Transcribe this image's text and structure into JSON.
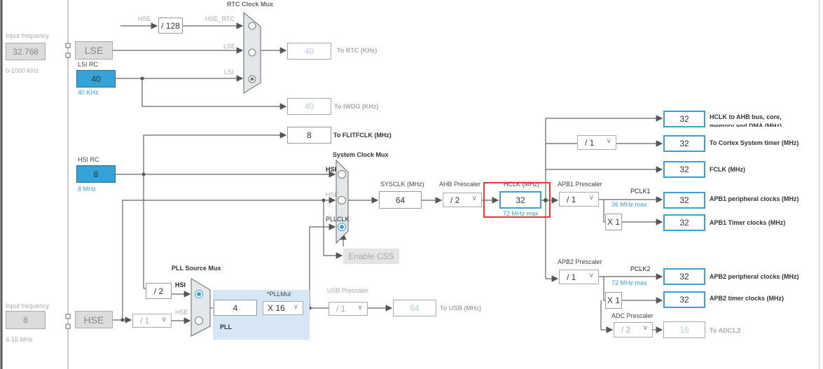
{
  "lse_input": {
    "label": "Input frequency",
    "value": "32.768",
    "range": "0-1000 KHz",
    "block": "LSE"
  },
  "lsi": {
    "label": "LSI RC",
    "value": "40",
    "freq": "40 KHz"
  },
  "hsi": {
    "label": "HSI RC",
    "value": "8",
    "freq": "8 MHz"
  },
  "hse_input": {
    "label": "Input frequency",
    "value": "8",
    "range": "4-16 MHz",
    "block": "HSE"
  },
  "rtc_mux": {
    "title": "RTC Clock Mux",
    "hse_in": "HSE",
    "div": "/ 128",
    "hse_rtc": "HSE_RTC",
    "lse": "LSE",
    "lsi": "LSI",
    "selected": "LSI"
  },
  "to_rtc": {
    "value": "40",
    "label": "To RTC (KHz)"
  },
  "to_iwdg": {
    "value": "40",
    "label": "To IWDG (KHz)"
  },
  "to_flitf": {
    "value": "8",
    "label": "To FLITFCLK (MHz)"
  },
  "sys_mux": {
    "title": "System Clock Mux",
    "hsi": "HSI",
    "hse": "HSE",
    "pllclk": "PLLCLK",
    "selected": "PLLCLK",
    "enable_css": "Enable CSS"
  },
  "sysclk": {
    "label": "SYSCLK (MHz)",
    "value": "64"
  },
  "ahb": {
    "label": "AHB Prescaler",
    "value": "/ 2"
  },
  "hclk": {
    "label": "HCLK (MHz)",
    "value": "32",
    "max": "72 MHz max"
  },
  "outputs": {
    "ahb": {
      "value": "32",
      "label": "HCLK to AHB bus, core, memory and DMA (MHz)"
    },
    "cortex": {
      "div": "/ 1",
      "value": "32",
      "label": "To Cortex System timer (MHz)"
    },
    "fclk": {
      "value": "32",
      "label": "FCLK (MHz)"
    },
    "apb1_periph": {
      "value": "32",
      "label": "APB1 peripheral clocks (MHz)"
    },
    "apb1_timer": {
      "mul": "X 1",
      "value": "32",
      "label": "APB1 Timer clocks (MHz)"
    },
    "apb2_periph": {
      "value": "32",
      "label": "APB2 peripheral clocks (MHz)"
    },
    "apb2_timer": {
      "mul": "X 1",
      "value": "32",
      "label": "APB2 timer clocks (MHz)"
    },
    "adc": {
      "prescaler_label": "ADC Prescaler",
      "div": "/ 2",
      "value": "16",
      "label": "To ADC1,2"
    }
  },
  "apb1": {
    "label": "APB1 Prescaler",
    "value": "/ 1",
    "pclk": "PCLK1",
    "max": "36 MHz max"
  },
  "apb2": {
    "label": "APB2 Prescaler",
    "value": "/ 1",
    "pclk": "PCLK2",
    "max": "72 MHz max"
  },
  "pll_mux": {
    "title": "PLL Source Mux",
    "hsi_div": "/ 2",
    "hsi": "HSI",
    "hse": "HSE",
    "hse_div": "/ 1",
    "selected": "HSI"
  },
  "pll": {
    "label": "PLL",
    "value": "4",
    "mul_label": "*PLLMul",
    "mul": "X 16"
  },
  "usb": {
    "label": "USB Prescaler",
    "div": "/ 1",
    "value": "64",
    "out_label": "To USB (MHz)"
  },
  "colors": {
    "accent": "#34a3d8",
    "highlight": "#e53935",
    "pll_bg": "#d6e6f4"
  }
}
